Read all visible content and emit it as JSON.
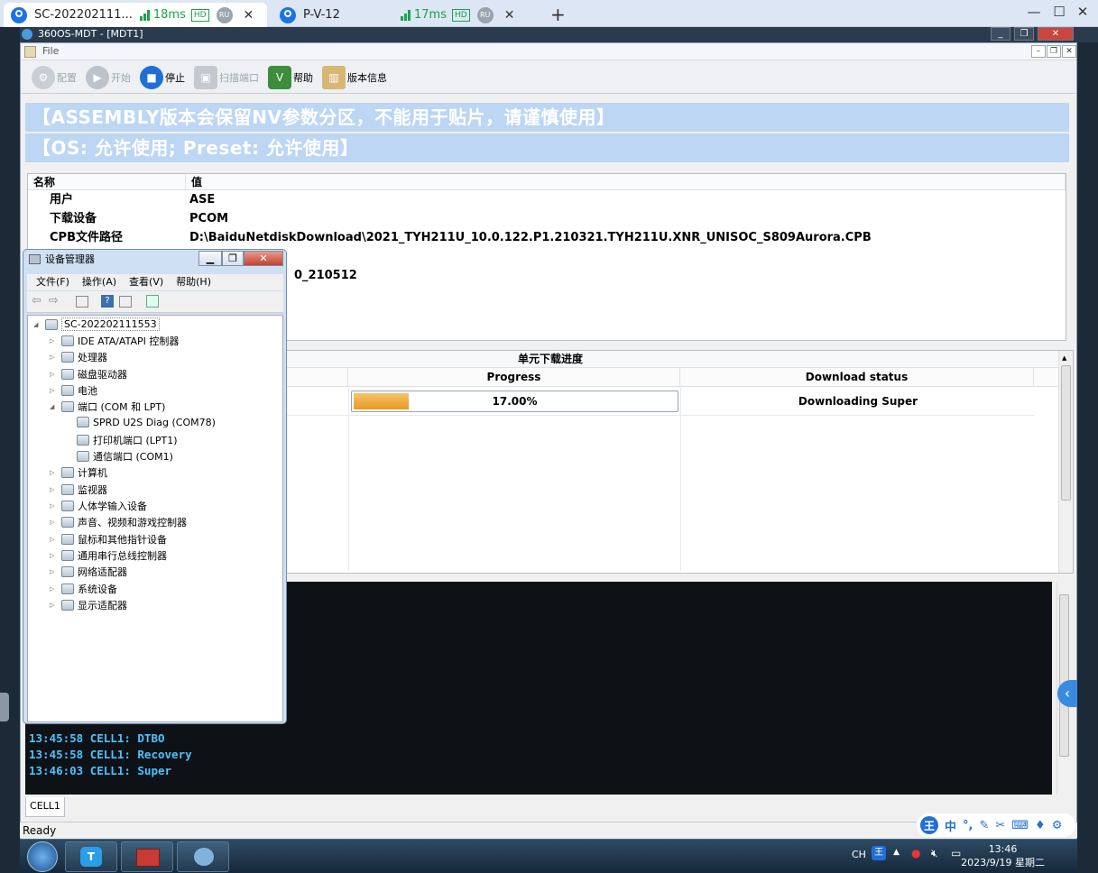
{
  "browser": {
    "tabs": [
      {
        "title": "SC-202202111...",
        "ping": "18ms",
        "hd": "HD",
        "region": "RU",
        "active": true
      },
      {
        "title": "P-V-12",
        "ping": "17ms",
        "hd": "HD",
        "region": "RU",
        "active": false
      }
    ],
    "new_tab": "+",
    "window_controls": [
      "—",
      "☐",
      "✕"
    ]
  },
  "remote_title": "360OS-MDT - [MDT1]",
  "app": {
    "menu": "File",
    "toolbar": [
      {
        "label": "配置",
        "icon": "gear-icon",
        "enabled": false
      },
      {
        "label": "开始",
        "icon": "play-icon",
        "enabled": false
      },
      {
        "label": "停止",
        "icon": "stop-icon",
        "enabled": true
      },
      {
        "label": "扫描端口",
        "icon": "android-icon",
        "enabled": false
      },
      {
        "label": "帮助",
        "icon": "help-icon",
        "enabled": true
      },
      {
        "label": "版本信息",
        "icon": "book-icon",
        "enabled": true
      }
    ],
    "banner1": "【ASSEMBLY版本会保留NV参数分区，不能用于贴片，请谨慎使用】",
    "banner2": "【OS: 允许使用; Preset: 允许使用】",
    "info": {
      "headers": [
        "名称",
        "值"
      ],
      "rows": [
        {
          "name": "用户",
          "value": "ASE"
        },
        {
          "name": "下载设备",
          "value": "PCOM"
        },
        {
          "name": "CPB文件路径",
          "value": "D:\\BaiduNetdiskDownload\\2021_TYH211U_10.0.122.P1.210321.TYH211U.XNR_UNISOC_S809Aurora.CPB"
        },
        {
          "name": "",
          "value": "0_210512"
        }
      ]
    },
    "progress": {
      "title": "单元下载进度",
      "columns": [
        "Progress",
        "Download status"
      ],
      "row": {
        "percent_text": "17.00%",
        "percent": 17,
        "status": "Downloading Super"
      }
    },
    "log": [
      "13:45:58  CELL1: DTBO",
      "13:45:58  CELL1: Recovery",
      "13:46:03  CELL1: Super"
    ],
    "cell_tab": "CELL1",
    "status": "Ready"
  },
  "device_manager": {
    "title": "设备管理器",
    "menu": [
      "文件(F)",
      "操作(A)",
      "查看(V)",
      "帮助(H)"
    ],
    "root": "SC-202202111553",
    "nodes": [
      {
        "label": "IDE ATA/ATAPI 控制器",
        "level": 1,
        "exp": "▷"
      },
      {
        "label": "处理器",
        "level": 1,
        "exp": "▷"
      },
      {
        "label": "磁盘驱动器",
        "level": 1,
        "exp": "▷"
      },
      {
        "label": "电池",
        "level": 1,
        "exp": "▷"
      },
      {
        "label": "端口 (COM 和 LPT)",
        "level": 1,
        "exp": "◢"
      },
      {
        "label": "SPRD U2S Diag (COM78)",
        "level": 2,
        "exp": ""
      },
      {
        "label": "打印机端口 (LPT1)",
        "level": 2,
        "exp": ""
      },
      {
        "label": "通信端口 (COM1)",
        "level": 2,
        "exp": ""
      },
      {
        "label": "计算机",
        "level": 1,
        "exp": "▷"
      },
      {
        "label": "监视器",
        "level": 1,
        "exp": "▷"
      },
      {
        "label": "人体学输入设备",
        "level": 1,
        "exp": "▷"
      },
      {
        "label": "声音、视频和游戏控制器",
        "level": 1,
        "exp": "▷"
      },
      {
        "label": "鼠标和其他指针设备",
        "level": 1,
        "exp": "▷"
      },
      {
        "label": "通用串行总线控制器",
        "level": 1,
        "exp": "▷"
      },
      {
        "label": "网络适配器",
        "level": 1,
        "exp": "▷"
      },
      {
        "label": "系统设备",
        "level": 1,
        "exp": "▷"
      },
      {
        "label": "显示适配器",
        "level": 1,
        "exp": "▷"
      }
    ]
  },
  "taskbar": {
    "lang": "CH",
    "time": "13:46",
    "date": "2023/9/19 星期二"
  },
  "ime": {
    "key": "王",
    "label": "中"
  },
  "colors": {
    "banner": "#bcd6f4",
    "log_text": "#4cc3ff",
    "progress": "#e79a22",
    "accent": "#1a73e8"
  }
}
